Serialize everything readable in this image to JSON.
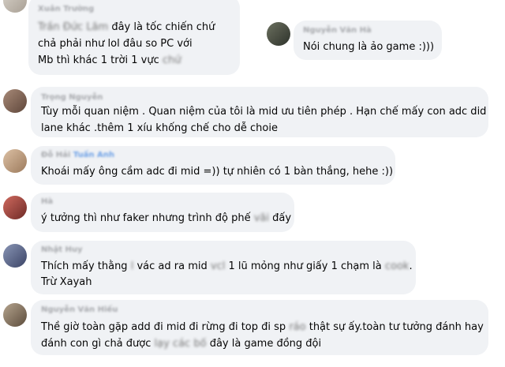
{
  "comments": [
    {
      "author": "Xuân Trường",
      "mention": "Trần Đức Lãm",
      "lines": [
        "đây là tốc chiến chứ",
        "chả phải như lol đâu so PC với",
        "Mb thì khác 1 trời 1 vực"
      ],
      "blurred_tail": "chứ",
      "avatar_color": "#c9c2b8"
    },
    {
      "author": "Nguyễn Văn Hà",
      "lines": [
        "Nói chung là ảo game :)))"
      ],
      "avatar_color": "#4a4f45"
    },
    {
      "author": "Trọng Nguyễn",
      "lines": [
        "Tùy mỗi quan niệm . Quan niệm của tôi là mid ưu tiên phép . Hạn chế mấy con adc did",
        "lane khác .thêm 1 xíu khống chế cho dễ choie"
      ],
      "avatar_color": "#8a6d5c"
    },
    {
      "author": "Đỗ Hải",
      "mention": "Tuấn Anh",
      "lines": [
        "Khoái mấy ông cầm adc đi mid =)) tự nhiên có 1 bàn thắng, hehe :))"
      ],
      "avatar_color": "#c4a182"
    },
    {
      "author": "Hà",
      "lines_parts": [
        "ý tưởng thì như faker nhưng trình độ phế",
        "đấy"
      ],
      "blurred_word": "vãi",
      "avatar_color": "#b9423c"
    },
    {
      "author": "Nhật Huy",
      "line1_parts": [
        "Thích mấy thằng",
        "vác ad ra mid",
        "1 lũ mỏng như giấy 1 chạm là",
        "."
      ],
      "blurred_words": [
        "l",
        "vcl",
        "cook"
      ],
      "line2": "Trừ Xayah",
      "avatar_color": "#5e6a8a"
    },
    {
      "author": "Nguyễn Văn Hiếu",
      "line1_parts": [
        "Thề giờ toàn gặp add đi mid đi rừng đi top đi sp",
        "thật sự ấy.toàn tư tưởng đánh hay"
      ],
      "line1_blur": "ráo",
      "line2_parts": [
        "đánh con gì chả được",
        "đây là game đồng đội"
      ],
      "line2_blur": "lạy các bố",
      "avatar_color": "#8b7a66"
    }
  ]
}
